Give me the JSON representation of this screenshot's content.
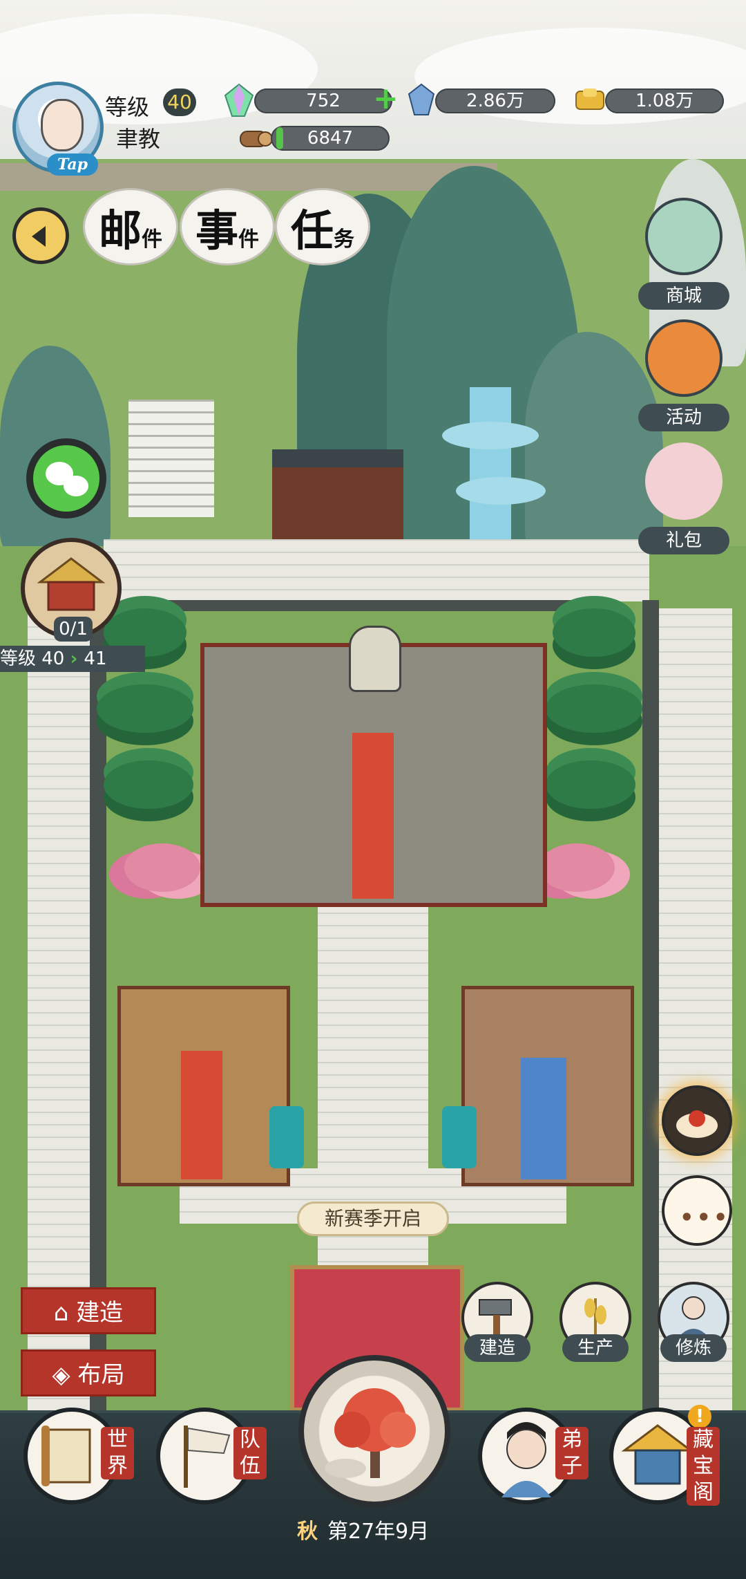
{
  "player": {
    "level_label": "等级",
    "level": "40",
    "sect_name": "聿教",
    "tap_badge": "Tap"
  },
  "resources": [
    {
      "name": "spirit-stone",
      "value": "752",
      "icon": "rainbow-crystal-icon"
    },
    {
      "name": "crystal",
      "value": "2.86万",
      "icon": "blue-crystal-icon"
    },
    {
      "name": "gold",
      "value": "1.08万",
      "icon": "gold-ingot-icon"
    },
    {
      "name": "wood",
      "value": "6847",
      "icon": "wood-log-icon"
    }
  ],
  "top_menu": {
    "mail": {
      "big": "邮",
      "small": "件"
    },
    "events": {
      "big": "事",
      "small": "件"
    },
    "tasks": {
      "big": "任",
      "small": "务"
    }
  },
  "right_menu": {
    "shop": "商城",
    "activity": "活动",
    "gift": "礼包"
  },
  "left_panel": {
    "progress": "0/1",
    "level_from": "等级 40",
    "level_to": "41"
  },
  "notice": "新赛季开启",
  "build_menu": {
    "build": "建造",
    "layout": "布局"
  },
  "tools": {
    "build": "建造",
    "produce": "生产",
    "cultivate": "修炼"
  },
  "bottom_nav": {
    "world": [
      "世",
      "界"
    ],
    "team": [
      "队",
      "伍"
    ],
    "disciple": [
      "弟",
      "子"
    ],
    "treasure": [
      "藏",
      "宝",
      "阁"
    ]
  },
  "season": {
    "season_name": "秋",
    "date": "第27年9月"
  },
  "colors": {
    "accent_red": "#b5352a",
    "panel_dark": "#3f4c52",
    "gold": "#f2d45c",
    "green_plus": "#4fce46"
  }
}
